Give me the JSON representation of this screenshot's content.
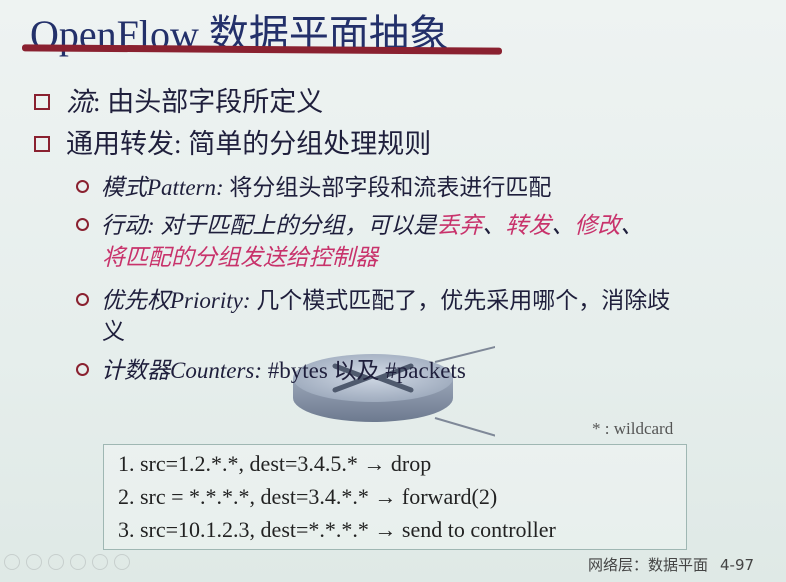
{
  "title": "OpenFlow 数据平面抽象",
  "bullets": [
    {
      "label": "流",
      "text": ": 由头部字段所定义"
    },
    {
      "label": "通用转发: 简单的分组处理规则"
    }
  ],
  "subbullets": {
    "pattern": {
      "label": "模式Pattern:",
      "text": " 将分组头部字段和流表进行匹配"
    },
    "action": {
      "label": "行动:",
      "text1": " 对于匹配上的分组，可以是",
      "drop": "丢弃",
      "sep1": "、",
      "forward": "转发",
      "sep2": "、",
      "modify": "修改",
      "sep3": "、",
      "line2": "将匹配的分组发送给控制器"
    },
    "priority": {
      "label": "优先权Priority:",
      "text": " 几个模式匹配了，优先采用哪个，消除歧",
      "line2": "义"
    },
    "counters": {
      "label": "计数器Counters:",
      "text": " #bytes 以及 #packets"
    }
  },
  "wildcard_note": "* : wildcard",
  "rules": [
    "1.   src=1.2.*.*, dest=3.4.5.* → drop",
    "2.   src = *.*.*.*, dest=3.4.*.* → forward(2)",
    "3.  src=10.1.2.3, dest=*.*.*.* → send to controller"
  ],
  "footer": {
    "section": "网络层：数据平面",
    "page": "4-97"
  },
  "colors": {
    "title": "#23306a",
    "accent": "#8a2130",
    "highlight": "#c8326b"
  }
}
